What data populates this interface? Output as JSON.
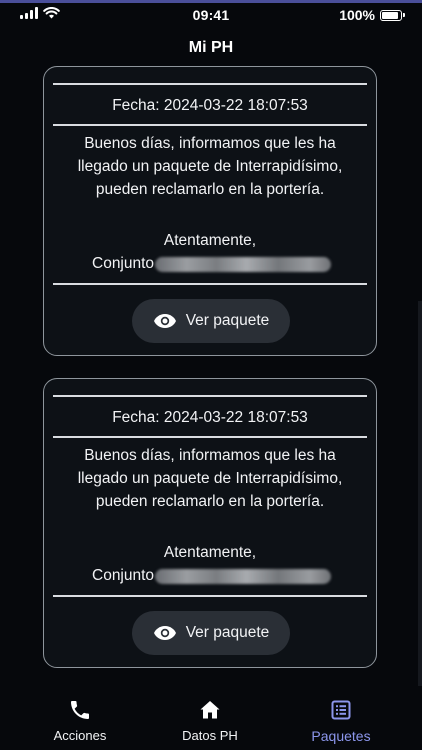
{
  "status_bar": {
    "time": "09:41",
    "battery_percent": "100%",
    "battery_level": 1.0,
    "signal_icon": "cellular-signal-icon",
    "wifi_icon": "wifi-icon"
  },
  "header": {
    "title": "Mi PH"
  },
  "notifications": [
    {
      "date": "Fecha: 2024-03-22 18:07:53",
      "message": "Buenos días, informamos que les ha llegado un paquete de Interrapidísimo, pueden reclamarlo en la portería.",
      "regards": "Atentamente,",
      "signature_prefix": "Conjunto",
      "button_label": "Ver paquete",
      "button_icon": "eye-icon"
    },
    {
      "date": "Fecha: 2024-03-22 18:07:53",
      "message": "Buenos días, informamos que les ha llegado un paquete de Interrapidísimo, pueden reclamarlo en la portería.",
      "regards": "Atentamente,",
      "signature_prefix": "Conjunto",
      "button_label": "Ver paquete",
      "button_icon": "eye-icon"
    }
  ],
  "bottom_nav": {
    "items": [
      {
        "label": "Acciones",
        "icon": "phone-icon",
        "active": false
      },
      {
        "label": "Datos PH",
        "icon": "home-icon",
        "active": false
      },
      {
        "label": "Paquetes",
        "icon": "list-icon",
        "active": true
      }
    ]
  },
  "colors": {
    "background": "#06080c",
    "card": "#0d1116",
    "button": "#2a2f36",
    "accent": "#8c96ec"
  }
}
